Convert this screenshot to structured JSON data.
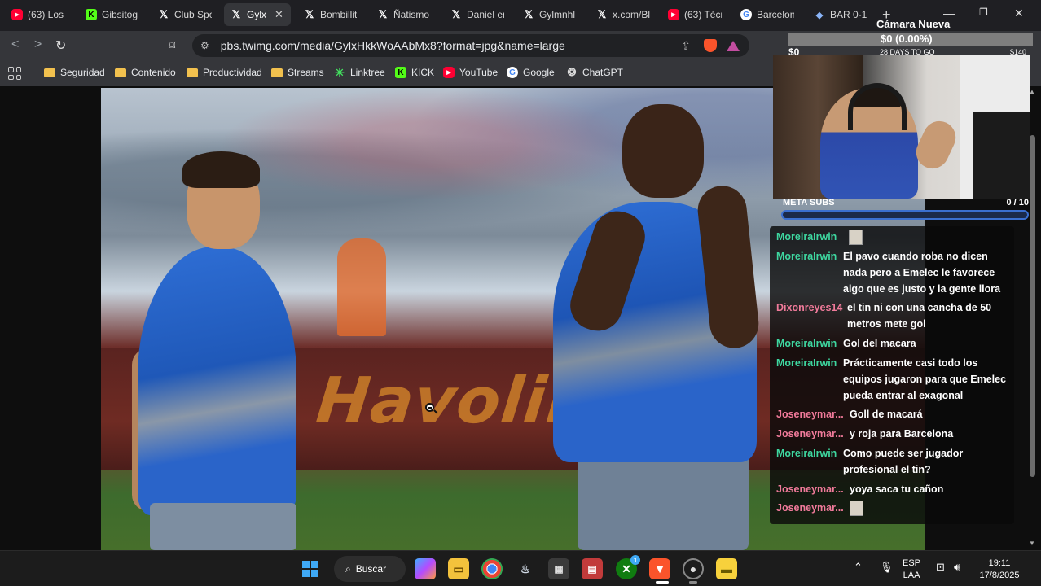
{
  "browser": {
    "tabs": [
      {
        "label": "(63) Los",
        "icon": "youtube-icon"
      },
      {
        "label": "Gibsitog",
        "icon": "kick-icon"
      },
      {
        "label": "Club Spo",
        "icon": "x-icon"
      },
      {
        "label": "Gylx",
        "icon": "x-icon",
        "active": true
      },
      {
        "label": "Bombillit",
        "icon": "x-icon"
      },
      {
        "label": "Ñatismo",
        "icon": "x-icon"
      },
      {
        "label": "Daniel en",
        "icon": "x-icon"
      },
      {
        "label": "Gylmnhl",
        "icon": "x-icon"
      },
      {
        "label": "x.com/Bl",
        "icon": "x-icon"
      },
      {
        "label": "(63) Técn",
        "icon": "youtube-icon"
      },
      {
        "label": "Barcelon",
        "icon": "google-icon"
      },
      {
        "label": "BAR 0-1",
        "icon": "brave-icon"
      }
    ],
    "url": "pbs.twimg.com/media/GylxHkkWoAAbMx8?format=jpg&name=large",
    "bookmarks": [
      {
        "label": "Seguridad",
        "type": "folder"
      },
      {
        "label": "Contenido",
        "type": "folder"
      },
      {
        "label": "Productividad",
        "type": "folder"
      },
      {
        "label": "Streams",
        "type": "folder"
      },
      {
        "label": "Linktree",
        "type": "linktree"
      },
      {
        "label": "KICK",
        "type": "kick"
      },
      {
        "label": "YouTube",
        "type": "youtube"
      },
      {
        "label": "Google",
        "type": "google"
      },
      {
        "label": "ChatGPT",
        "type": "chatgpt"
      }
    ]
  },
  "photo": {
    "ad_text": "Havoline"
  },
  "overlay": {
    "camera_title": "Cámara Nueva",
    "goal_amount": "$0 (0.00%)",
    "goal_min": "$0",
    "goal_days": "28 DAYS TO GO",
    "goal_max": "$140",
    "subs_label": "META SUBS",
    "subs_count": "0  / 10",
    "subs_progress": 0
  },
  "chat": [
    {
      "user": "MoreiraIrwin",
      "color": "#3ed7a0",
      "text": "",
      "emote": true
    },
    {
      "user": "MoreiraIrwin",
      "color": "#3ed7a0",
      "text": "El pavo cuando roba no dicen nada pero a Emelec le favorece algo que es justo y la gente llora"
    },
    {
      "user": "Dixonreyes14",
      "color": "#f07a9a",
      "text": "el tin ni con una cancha de 50 metros mete gol"
    },
    {
      "user": "MoreiraIrwin",
      "color": "#3ed7a0",
      "text": "Gol del macara"
    },
    {
      "user": "MoreiraIrwin",
      "color": "#3ed7a0",
      "text": "Prácticamente casi todo los equipos jugaron para que Emelec pueda entrar al exagonal"
    },
    {
      "user": "Joseneymar...",
      "color": "#f07a9a",
      "text": "Goll de macará"
    },
    {
      "user": "Joseneymar...",
      "color": "#f07a9a",
      "text": "y roja para Barcelona"
    },
    {
      "user": "MoreiraIrwin",
      "color": "#3ed7a0",
      "text": "Como puede ser jugador profesional el tin?"
    },
    {
      "user": "Joseneymar...",
      "color": "#f07a9a",
      "text": "yoya saca tu cañon"
    },
    {
      "user": "Joseneymar...",
      "color": "#f07a9a",
      "text": "",
      "emote": true
    }
  ],
  "taskbar": {
    "search_label": "Buscar",
    "lang_top": "ESP",
    "lang_bottom": "LAA",
    "time": "19:11",
    "date": "17/8/2025",
    "xbox_badge": "1"
  }
}
